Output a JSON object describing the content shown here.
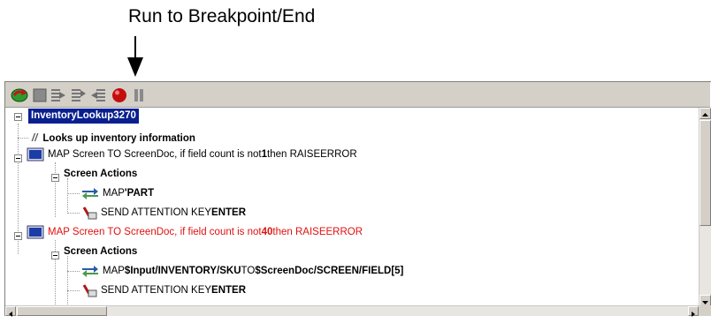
{
  "callout": {
    "text": "Run to Breakpoint/End"
  },
  "toolbar": {
    "buttons": [
      {
        "name": "run-to-breakpoint-icon"
      },
      {
        "name": "stop-icon"
      },
      {
        "name": "step-into-icon"
      },
      {
        "name": "step-over-icon"
      },
      {
        "name": "step-out-icon"
      },
      {
        "name": "breakpoint-icon"
      },
      {
        "name": "pause-icon"
      }
    ]
  },
  "tree": {
    "root": "InventoryLookup3270",
    "comment": "Looks up inventory information",
    "step1": {
      "pre": "MAP Screen TO ScreenDoc, if field count is not ",
      "num": "1",
      "post": " then RAISEERROR"
    },
    "actions1": "Screen Actions",
    "map1": {
      "pre": "MAP ",
      "val": "'PART"
    },
    "send1": {
      "pre": "SEND ATTENTION KEY ",
      "key": "ENTER"
    },
    "step2": {
      "pre": "MAP Screen TO ScreenDoc, if field count is not ",
      "num": "40",
      "post": " then RAISEERROR"
    },
    "actions2": "Screen Actions",
    "map2": {
      "pre": "MAP ",
      "src": "$Input/INVENTORY/SKU",
      "mid": " TO ",
      "dst": "$ScreenDoc/SCREEN/FIELD[5]"
    },
    "send2": {
      "pre": "SEND ATTENTION KEY ",
      "key": "ENTER"
    }
  },
  "colors": {
    "selection": "#0a1f8f",
    "error_text": "#e01010",
    "toolbar_bg": "#d4d0c8"
  }
}
